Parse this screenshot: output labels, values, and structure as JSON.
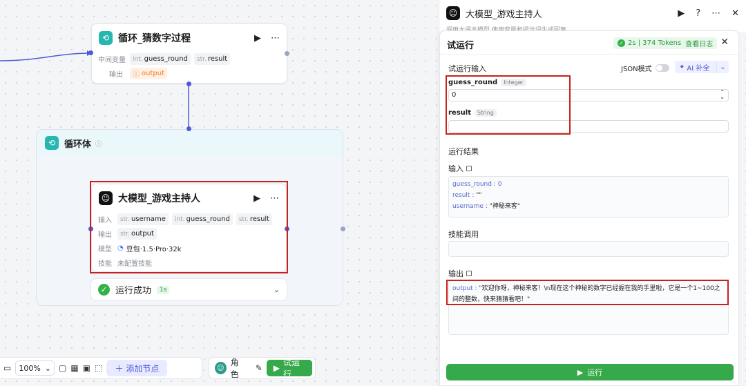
{
  "nodes": {
    "loop_process": {
      "title": "循环_猜数字过程",
      "row1_label": "中间变量",
      "row2_label": "输出",
      "vars": [
        {
          "type": "int.",
          "name": "guess_round"
        },
        {
          "type": "str.",
          "name": "result"
        }
      ],
      "output": "output"
    },
    "loop_body": {
      "title": "循环体"
    },
    "llm_host": {
      "title": "大模型_游戏主持人",
      "input_label": "输入",
      "output_label": "输出",
      "model_label": "模型",
      "skill_label": "技能",
      "inputs": [
        {
          "type": "str.",
          "name": "username"
        },
        {
          "type": "int.",
          "name": "guess_round"
        },
        {
          "type": "str.",
          "name": "result"
        }
      ],
      "output": {
        "type": "str.",
        "name": "output"
      },
      "model": "豆包·1.5·Pro·32k",
      "skill": "未配置技能"
    },
    "status": {
      "text": "运行成功",
      "time": "1s"
    }
  },
  "toolbar": {
    "zoom": "100%",
    "add_node": "添加节点",
    "role": "角色",
    "trial_run": "试运行"
  },
  "panel_header": {
    "title": "大模型_游戏主持人",
    "subtitle": "调用大语言模型,使用变量和提示词生成回复"
  },
  "trial_panel": {
    "title": "试运行",
    "badge": "2s | 374 Tokens",
    "view_log": "查看日志",
    "input_section": "试运行输入",
    "json_mode": "JSON模式",
    "ai_fill": "AI 补全",
    "fields": [
      {
        "name": "guess_round",
        "type": "Integer",
        "value": "0"
      },
      {
        "name": "result",
        "type": "String",
        "value": ""
      }
    ],
    "result_section": "运行结果",
    "input_label": "输入",
    "input_lines": [
      {
        "key": "guess_round",
        "value": "0"
      },
      {
        "key": "result",
        "value": "\"\""
      },
      {
        "key": "username",
        "value": "\"神秘来客\""
      }
    ],
    "skill_call_label": "技能调用",
    "output_label": "输出",
    "output_key": "output",
    "output_value": "\"欢迎你呀，神秘来客！\\n现在这个神秘的数字已经握在我的手里啦，它是一个1~100之间的整数，快来猜猜看吧！\"",
    "run_button": "运行"
  },
  "colors": {
    "accent": "#4e5bd6",
    "success": "#36a94a",
    "highlight": "#c8201a",
    "loop_icon": "#27b7b0"
  }
}
